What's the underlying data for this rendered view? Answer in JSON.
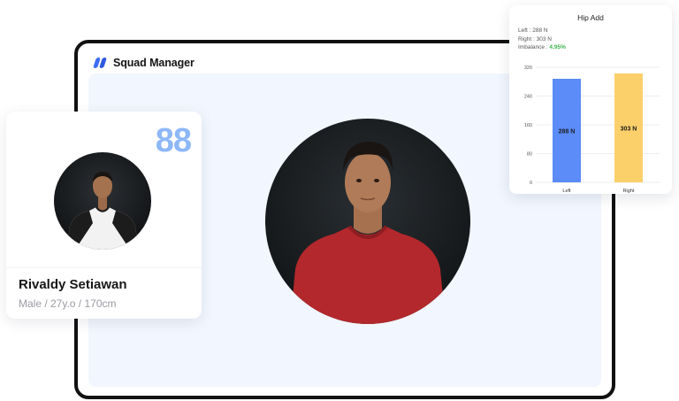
{
  "app": {
    "title": "Squad Manager"
  },
  "profile": {
    "score": "88",
    "name": "Rivaldy Setiawan",
    "meta": "Male / 27y.o / 170cm"
  },
  "chart_card": {
    "title": "Hip Add",
    "left_label": "Left",
    "left_value": "288 N",
    "right_label": "Right",
    "right_value": "303 N",
    "imbalance_label": "Imbalance :",
    "imbalance_value": "4.95%",
    "imbalance_color": "#3cb34a"
  },
  "chart_data": {
    "type": "bar",
    "title": "Hip Add",
    "categories": [
      "Left",
      "Right"
    ],
    "values": [
      288,
      303
    ],
    "data_labels": [
      "288 N",
      "303 N"
    ],
    "colors": [
      "#5b8cf7",
      "#fbd06b"
    ],
    "ylim": [
      0,
      320
    ],
    "yticks": [
      0,
      80,
      160,
      240,
      320
    ],
    "grid": true
  },
  "colors": {
    "accent": "#3f6df6",
    "score": "#8db7f7",
    "content_bg": "#f2f6fe"
  },
  "icons": {
    "logo": "squad-manager-logo-icon"
  }
}
